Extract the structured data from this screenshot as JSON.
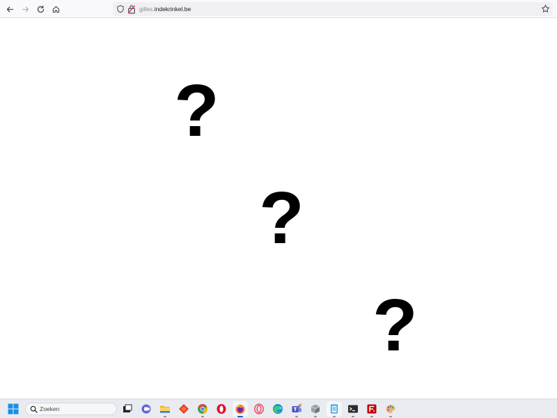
{
  "browser": {
    "url_subdomain": "gilles.",
    "url_domain": "indekrinkel.be",
    "icons": {
      "back": "back-arrow-icon",
      "forward": "forward-arrow-icon",
      "reload": "reload-icon",
      "home": "home-icon",
      "tracking": "shield-icon",
      "security": "insecure-lock-icon",
      "bookmark": "star-icon"
    }
  },
  "page": {
    "marks": [
      "?",
      "?",
      "?"
    ]
  },
  "taskbar": {
    "search_placeholder": "Zoeken",
    "apps": [
      "start-menu",
      "task-view",
      "teams-chat",
      "file-explorer",
      "git-client",
      "chrome",
      "opera",
      "firefox",
      "opera-gx",
      "edge",
      "teams",
      "package-manager",
      "notepad",
      "terminal",
      "filezilla",
      "paint"
    ]
  }
}
